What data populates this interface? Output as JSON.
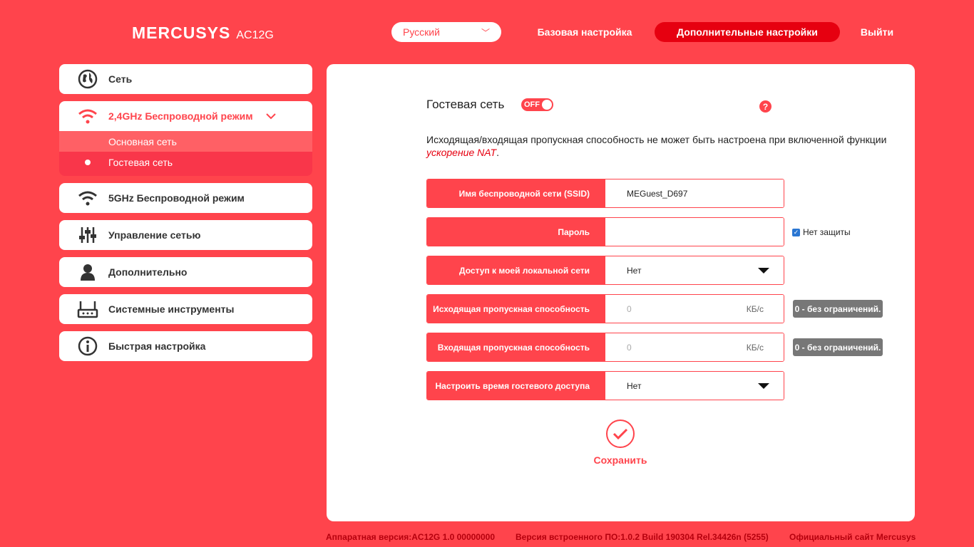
{
  "header": {
    "brand": "MERCUSYS",
    "model": "AC12G",
    "language": "Русский",
    "nav": [
      "Базовая настройка",
      "Дополнительные настройки",
      "Выйти"
    ]
  },
  "sidebar": {
    "items": [
      {
        "label": "Сеть",
        "icon": "globe-icon"
      },
      {
        "label": "2,4GHz Беспроводной режим",
        "icon": "wifi-icon"
      },
      {
        "label": "5GHz Беспроводной режим",
        "icon": "wifi-icon"
      },
      {
        "label": "Управление сетью",
        "icon": "sliders-icon"
      },
      {
        "label": "Дополнительно",
        "icon": "user-icon"
      },
      {
        "label": "Системные инструменты",
        "icon": "router-icon"
      },
      {
        "label": "Быстрая настройка",
        "icon": "info-icon"
      }
    ],
    "submenu": [
      "Основная сеть",
      "Гостевая сеть"
    ]
  },
  "main": {
    "title": "Гостевая сеть",
    "toggle": "OFF",
    "help": "?",
    "notice_prefix": "Исходящая/входящая пропускная способность не может быть настроена при включенной функции",
    "notice_link": "ускорение NAT",
    "notice_suffix": ".",
    "fields": {
      "ssid_label": "Имя беспроводной сети (SSID)",
      "ssid_value": "MEGuest_D697",
      "password_label": "Пароль",
      "password_value": "",
      "no_security": "Нет защиты",
      "lan_access_label": "Доступ к моей локальной сети",
      "lan_access_value": "Нет",
      "upload_label": "Исходящая пропускная способность",
      "upload_placeholder": "0",
      "download_label": "Входящая пропускная способность",
      "download_placeholder": "0",
      "unit": "КБ/с",
      "limit_tip": "0 - без ограничений.",
      "time_label": "Настроить время гостевого доступа",
      "time_value": "Нет"
    },
    "save_label": "Сохранить"
  },
  "footer": {
    "hardware": "Аппаратная версия:AC12G 1.0 00000000",
    "firmware": "Версия встроенного ПО:1.0.2 Build 190304 Rel.34426n (5255)",
    "site": "Официальный сайт Mercusys"
  },
  "colors": {
    "accent": "#ff444c",
    "active_nav": "#e60010",
    "tip": "#777777"
  }
}
